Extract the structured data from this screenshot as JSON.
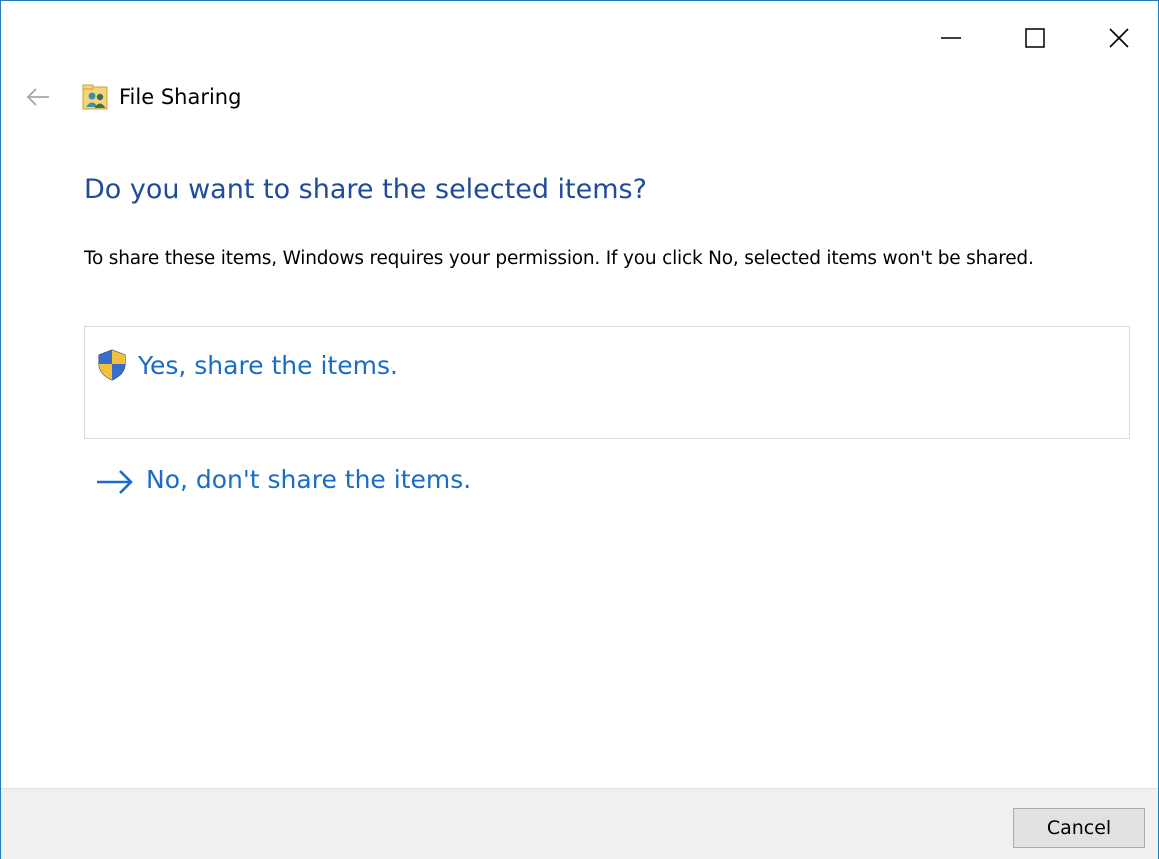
{
  "window": {
    "title": "File Sharing",
    "icons": {
      "back": "arrow-left-icon",
      "title": "file-sharing-users-icon",
      "minimize": "minimize-icon",
      "maximize": "maximize-icon",
      "close": "close-icon"
    }
  },
  "main": {
    "heading": "Do you want to share the selected items?",
    "description": "To share these items, Windows requires your permission. If you click No, selected items won't be shared.",
    "options": [
      {
        "label": "Yes, share the items.",
        "icon": "uac-shield-icon"
      },
      {
        "label": "No, don't share the items.",
        "icon": "arrow-right-icon"
      }
    ]
  },
  "footer": {
    "cancel_label": "Cancel"
  },
  "colors": {
    "heading": "#1f4b9c",
    "link": "#1a6dc5",
    "window_border": "#1f7ac7",
    "footer_bg": "#f0f0f0"
  }
}
